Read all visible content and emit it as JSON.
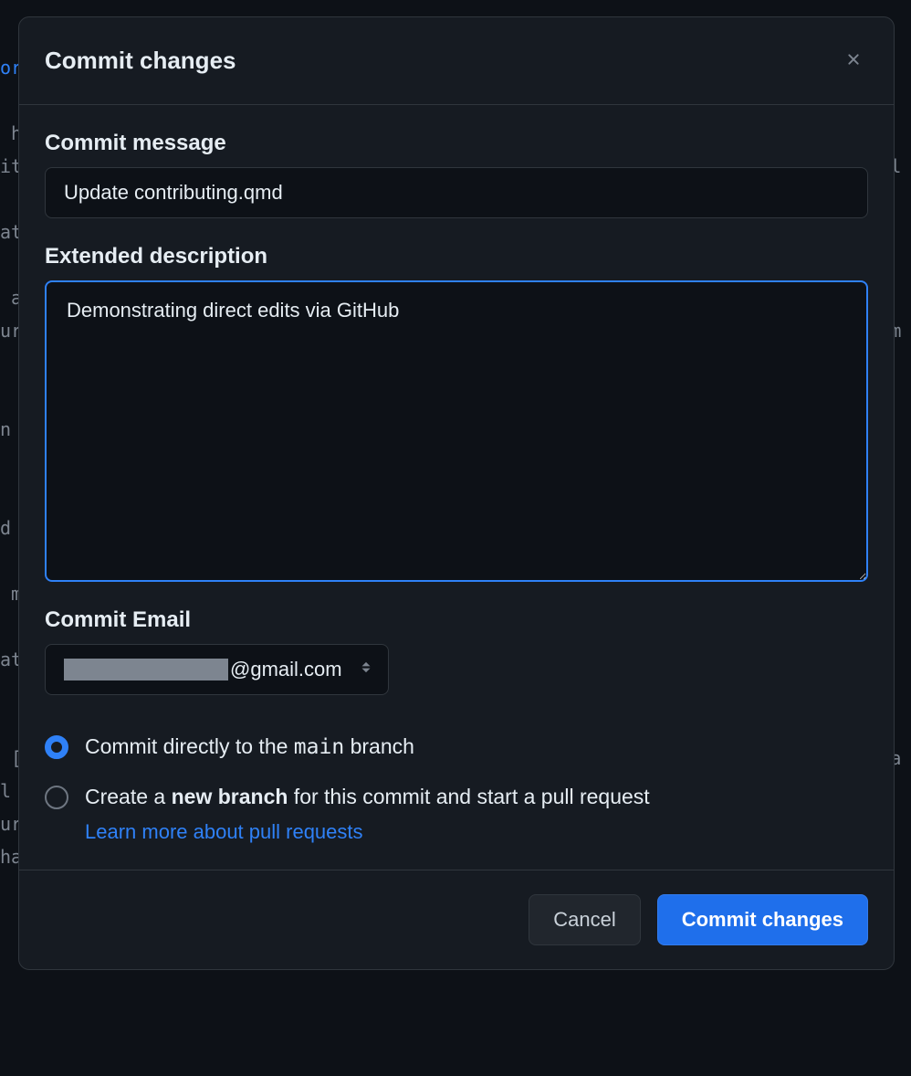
{
  "modal": {
    "title": "Commit changes",
    "commit_message": {
      "label": "Commit message",
      "value": "Update contributing.qmd"
    },
    "extended_description": {
      "label": "Extended description",
      "value": "Demonstrating direct edits via GitHub"
    },
    "commit_email": {
      "label": "Commit Email",
      "domain": "@gmail.com"
    },
    "branch_options": {
      "direct": {
        "prefix": "Commit directly to the ",
        "branch": "main",
        "suffix": " branch",
        "checked": true
      },
      "new_branch": {
        "prefix": "Create a ",
        "bold": "new branch",
        "suffix": " for this commit and start a pull request",
        "learn_more": "Learn more about pull requests",
        "checked": false
      }
    },
    "footer": {
      "cancel": "Cancel",
      "commit": "Commit changes"
    }
  }
}
